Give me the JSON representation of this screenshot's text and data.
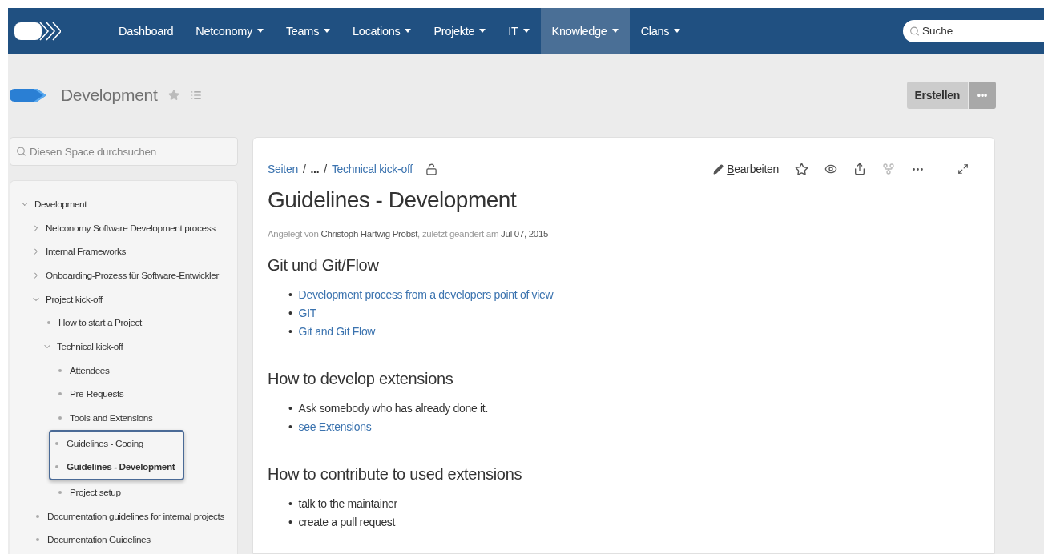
{
  "nav": {
    "items": [
      {
        "label": "Dashboard",
        "dropdown": false,
        "selected": false
      },
      {
        "label": "Netconomy",
        "dropdown": true,
        "selected": false
      },
      {
        "label": "Teams",
        "dropdown": true,
        "selected": false
      },
      {
        "label": "Locations",
        "dropdown": true,
        "selected": false
      },
      {
        "label": "Projekte",
        "dropdown": true,
        "selected": false
      },
      {
        "label": "IT",
        "dropdown": true,
        "selected": false
      },
      {
        "label": "Knowledge",
        "dropdown": true,
        "selected": true
      },
      {
        "label": "Clans",
        "dropdown": true,
        "selected": false
      }
    ],
    "search": {
      "placeholder": "Suche"
    }
  },
  "space": {
    "title": "Development",
    "create_button": "Erstellen",
    "more_button": "•••"
  },
  "sidebar": {
    "search": {
      "placeholder": "Diesen Space durchsuchen"
    },
    "tree": [
      {
        "label": "Development",
        "kind": "expanded",
        "selected": false,
        "highlighted": false,
        "children": [
          {
            "label": "Netconomy Software Development process",
            "kind": "collapsed",
            "selected": false,
            "highlighted": false
          },
          {
            "label": "Internal Frameworks",
            "kind": "collapsed",
            "selected": false,
            "highlighted": false
          },
          {
            "label": "Onboarding-Prozess für Software-Entwickler",
            "kind": "collapsed",
            "selected": false,
            "highlighted": false
          },
          {
            "label": "Project kick-off",
            "kind": "expanded",
            "selected": false,
            "highlighted": false,
            "children": [
              {
                "label": "How to start a Project",
                "kind": "leaf",
                "selected": false,
                "highlighted": false
              },
              {
                "label": "Technical kick-off",
                "kind": "expanded",
                "selected": false,
                "highlighted": false,
                "children": [
                  {
                    "label": "Attendees",
                    "kind": "leaf",
                    "selected": false,
                    "highlighted": false
                  },
                  {
                    "label": "Pre-Requests",
                    "kind": "leaf",
                    "selected": false,
                    "highlighted": false
                  },
                  {
                    "label": "Tools and Extensions",
                    "kind": "leaf",
                    "selected": false,
                    "highlighted": false
                  },
                  {
                    "label": "Guidelines - Coding",
                    "kind": "leaf",
                    "selected": false,
                    "highlighted": true
                  },
                  {
                    "label": "Guidelines - Development",
                    "kind": "leaf",
                    "selected": true,
                    "highlighted": true
                  },
                  {
                    "label": "Project setup",
                    "kind": "leaf",
                    "selected": false,
                    "highlighted": false
                  }
                ]
              }
            ]
          },
          {
            "label": "Documentation guidelines for internal projects",
            "kind": "leaf",
            "selected": false,
            "highlighted": false
          },
          {
            "label": "Documentation Guidelines",
            "kind": "leaf",
            "selected": false,
            "highlighted": false
          }
        ]
      }
    ]
  },
  "page": {
    "breadcrumbs": [
      {
        "label": "Seiten",
        "kind": "link"
      },
      {
        "label": "/",
        "kind": "sep"
      },
      {
        "label": "...",
        "kind": "ellipsis"
      },
      {
        "label": "/",
        "kind": "sep"
      },
      {
        "label": "Technical kick-off",
        "kind": "link"
      }
    ],
    "edit_button": "Bearbeiten",
    "title": "Guidelines - Development",
    "byline": [
      {
        "text": "Angelegt von",
        "kind": "plain"
      },
      {
        "text": "Christoph Hartwig Probst",
        "kind": "name"
      },
      {
        "text": ", zuletzt geändert am",
        "kind": "plain"
      },
      {
        "text": "Jul 07, 2015",
        "kind": "name"
      }
    ],
    "sections": [
      {
        "heading": "Git und Git/Flow",
        "items": [
          {
            "marker": "•",
            "text": "Development process from a developers point of view",
            "kind": "link"
          },
          {
            "marker": "•",
            "text": "GIT",
            "kind": "link"
          },
          {
            "marker": "•",
            "text": "Git and Git Flow",
            "kind": "link"
          }
        ]
      },
      {
        "heading": "How to develop extensions",
        "items": [
          {
            "marker": "•",
            "text": "Ask somebody who has already done it.",
            "kind": "text"
          },
          {
            "marker": "•",
            "text": "see Extensions",
            "kind": "link"
          }
        ]
      },
      {
        "heading": "How to contribute to used extensions",
        "items": [
          {
            "marker": "•",
            "text": "talk to the maintainer",
            "kind": "text"
          },
          {
            "marker": "•",
            "text": "create a pull request",
            "kind": "text"
          }
        ]
      }
    ]
  }
}
